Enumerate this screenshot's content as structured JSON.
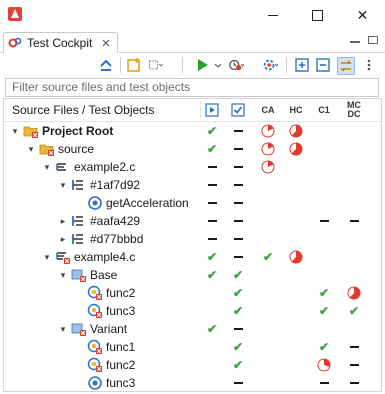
{
  "window": {
    "icon": "app-logo-icon"
  },
  "tab": {
    "label": "Test Cockpit",
    "close": "✕"
  },
  "filter": {
    "placeholder": "Filter source files and test objects"
  },
  "header": {
    "source": "Source Files / Test Objects",
    "ca": "CA",
    "hc": "HC",
    "c1": "C1",
    "mcdc_line1": "MC",
    "mcdc_line2": "DC"
  },
  "rows": [
    {
      "label": "Project Root",
      "bold": true,
      "indent": 0,
      "expander": "▾",
      "icon": "project-folder-icon",
      "cells": {
        "run": "check",
        "ok": "dash",
        "ca": "pie-low",
        "hc": "pie-high",
        "c1": "",
        "mcdc": ""
      }
    },
    {
      "label": "source",
      "bold": false,
      "indent": 1,
      "expander": "▾",
      "icon": "folder-icon",
      "cells": {
        "run": "check",
        "ok": "dash",
        "ca": "pie-low",
        "hc": "pie-high",
        "c1": "",
        "mcdc": ""
      }
    },
    {
      "label": "example2.c",
      "bold": false,
      "indent": 2,
      "expander": "▾",
      "icon": "source-file-icon",
      "cells": {
        "run": "dash",
        "ok": "dash",
        "ca": "pie-low",
        "hc": "",
        "c1": "",
        "mcdc": ""
      }
    },
    {
      "label": "#1af7d92",
      "bold": false,
      "indent": 3,
      "expander": "▾",
      "icon": "hash-variant-icon",
      "cells": {
        "run": "dash",
        "ok": "dash",
        "ca": "",
        "hc": "",
        "c1": "",
        "mcdc": ""
      }
    },
    {
      "label": "getAcceleration",
      "bold": false,
      "indent": 4,
      "expander": "",
      "icon": "function-icon",
      "cells": {
        "run": "dash",
        "ok": "dash",
        "ca": "",
        "hc": "",
        "c1": "",
        "mcdc": ""
      }
    },
    {
      "label": "#aafa429",
      "bold": false,
      "indent": 3,
      "expander": "▸",
      "icon": "hash-variant-icon",
      "cells": {
        "run": "dash",
        "ok": "dash",
        "ca": "",
        "hc": "",
        "c1": "dash",
        "mcdc": "dash"
      }
    },
    {
      "label": "#d77bbbd",
      "bold": false,
      "indent": 3,
      "expander": "▸",
      "icon": "hash-variant-icon",
      "cells": {
        "run": "dash",
        "ok": "dash",
        "ca": "",
        "hc": "",
        "c1": "",
        "mcdc": ""
      }
    },
    {
      "label": "example4.c",
      "bold": false,
      "indent": 2,
      "expander": "▾",
      "icon": "source-file-error-icon",
      "cells": {
        "run": "check",
        "ok": "dash",
        "ca": "check",
        "hc": "pie-high",
        "c1": "",
        "mcdc": ""
      }
    },
    {
      "label": "Base",
      "bold": false,
      "indent": 3,
      "expander": "▾",
      "icon": "variant-group-icon",
      "cells": {
        "run": "check",
        "ok": "check",
        "ca": "",
        "hc": "",
        "c1": "",
        "mcdc": ""
      }
    },
    {
      "label": "func2",
      "bold": false,
      "indent": 4,
      "expander": "",
      "icon": "function-error-icon",
      "cells": {
        "run": "",
        "ok": "check",
        "ca": "",
        "hc": "",
        "c1": "check",
        "mcdc": "pie-high"
      }
    },
    {
      "label": "func3",
      "bold": false,
      "indent": 4,
      "expander": "",
      "icon": "function-error-icon",
      "cells": {
        "run": "",
        "ok": "check",
        "ca": "",
        "hc": "",
        "c1": "check",
        "mcdc": "check"
      }
    },
    {
      "label": "Variant",
      "bold": false,
      "indent": 3,
      "expander": "▾",
      "icon": "variant-group-icon",
      "cells": {
        "run": "check",
        "ok": "dash",
        "ca": "",
        "hc": "",
        "c1": "",
        "mcdc": ""
      }
    },
    {
      "label": "func1",
      "bold": false,
      "indent": 4,
      "expander": "",
      "icon": "function-error-icon",
      "cells": {
        "run": "",
        "ok": "check",
        "ca": "",
        "hc": "",
        "c1": "check",
        "mcdc": "dash"
      }
    },
    {
      "label": "func2",
      "bold": false,
      "indent": 4,
      "expander": "",
      "icon": "function-error-icon",
      "cells": {
        "run": "",
        "ok": "check",
        "ca": "",
        "hc": "",
        "c1": "pie-mid",
        "mcdc": "dash"
      }
    },
    {
      "label": "func3",
      "bold": false,
      "indent": 4,
      "expander": "",
      "icon": "function-icon",
      "cells": {
        "run": "",
        "ok": "dash",
        "ca": "",
        "hc": "",
        "c1": "dash",
        "mcdc": "dash"
      }
    }
  ],
  "colors": {
    "check": "#3aa33a",
    "pie": "#e03a2e",
    "accent": "#2a72c8"
  }
}
